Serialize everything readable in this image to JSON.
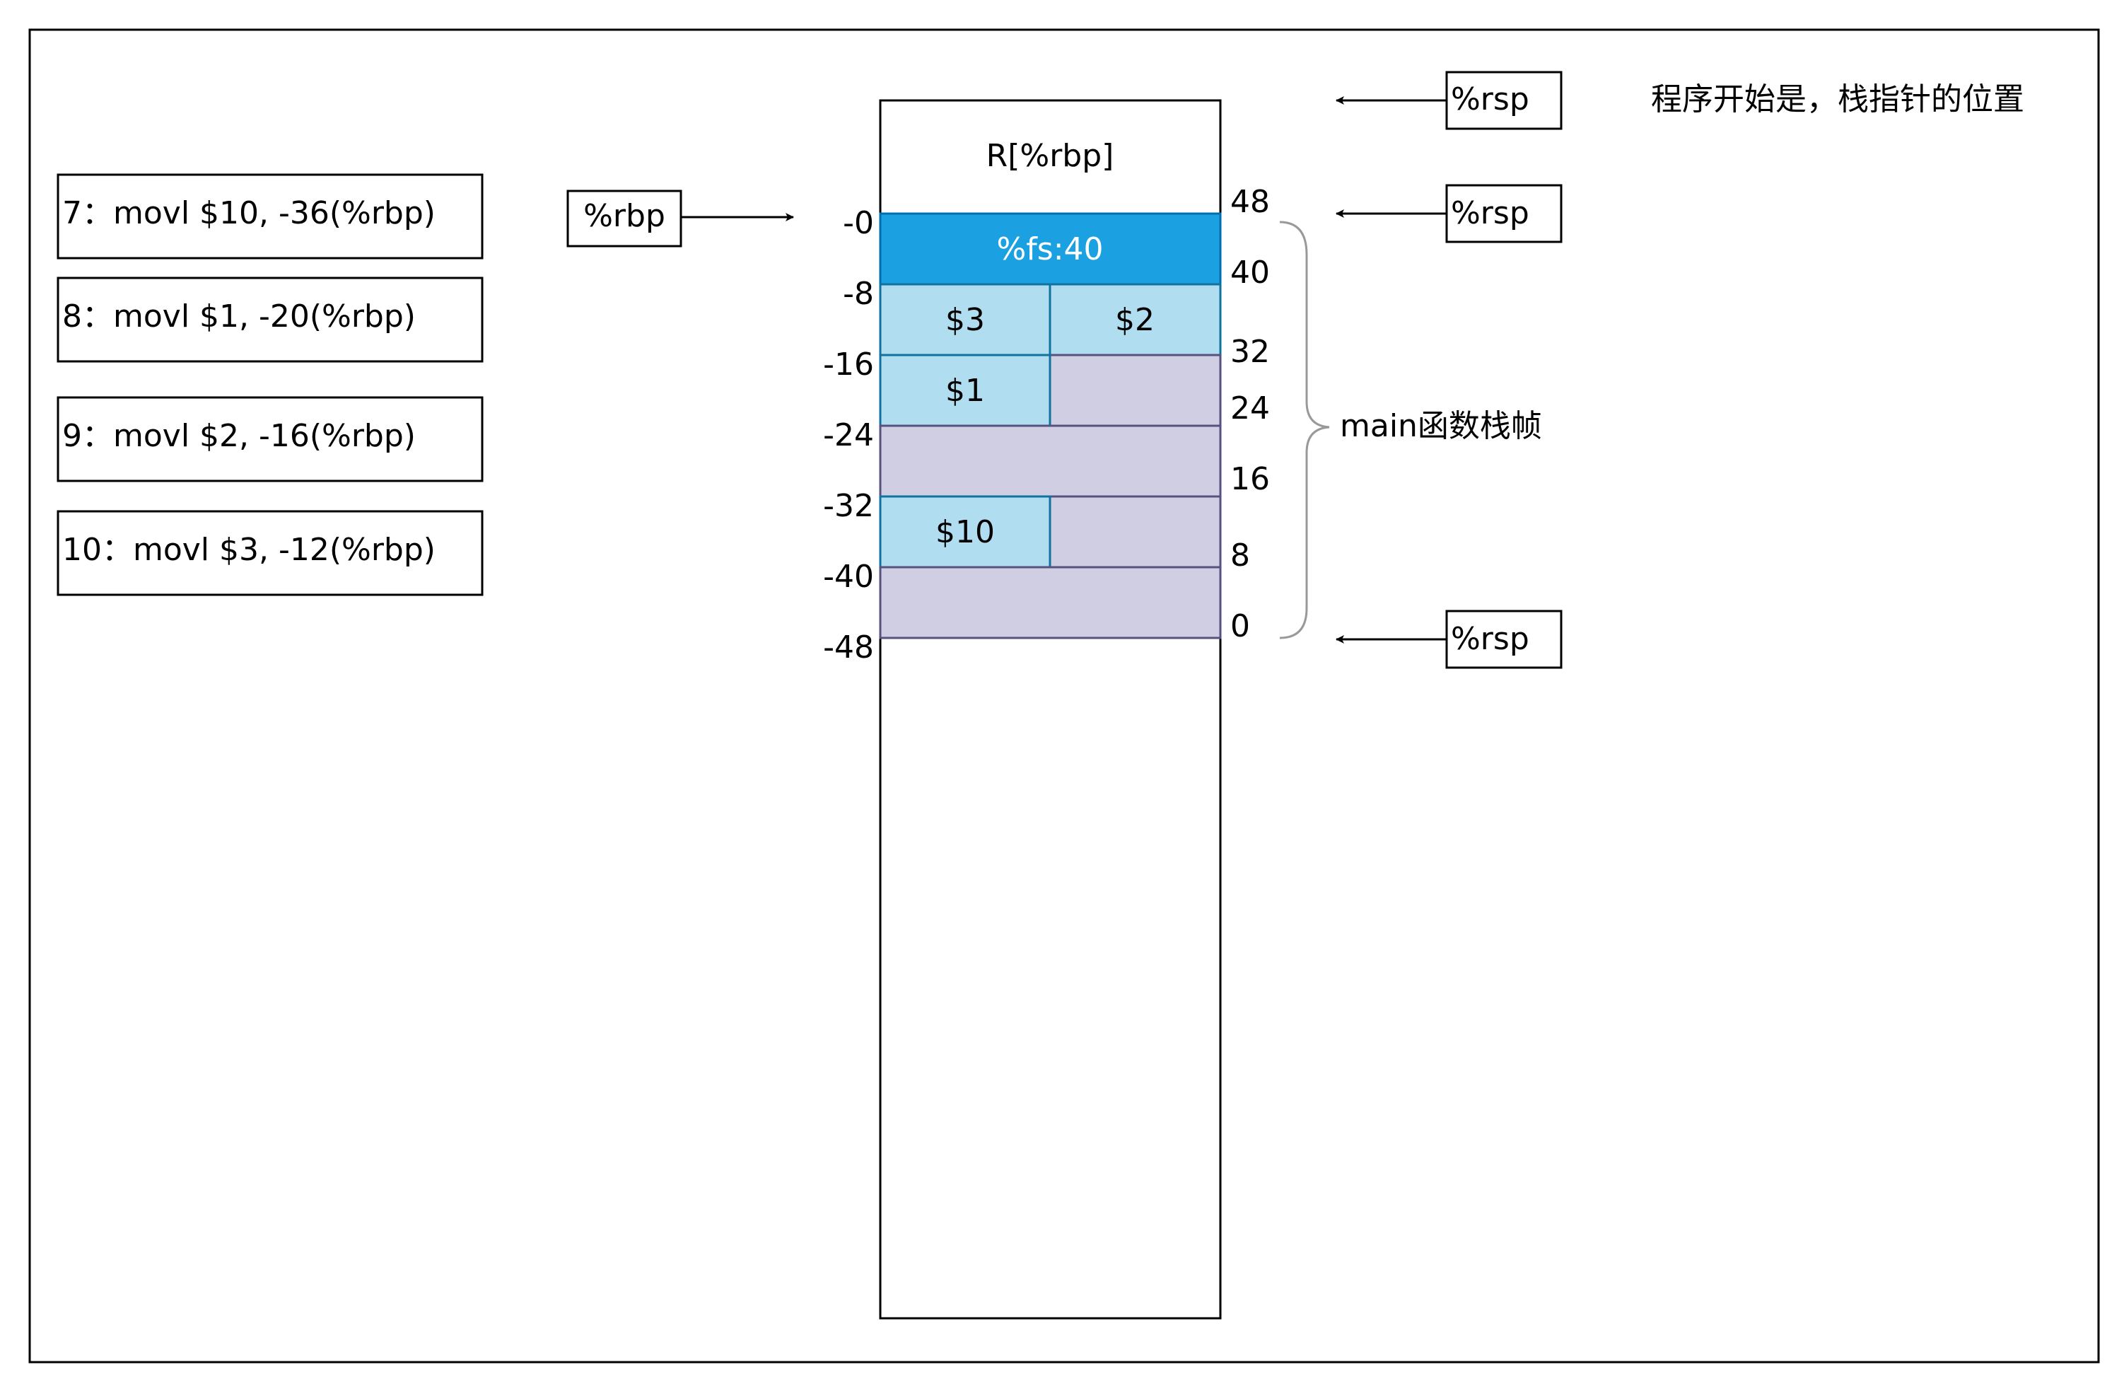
{
  "instructions": [
    "7：movl    $10, -36(%rbp)",
    "8：movl    $1, -20(%rbp)",
    "9：movl    $2, -16(%rbp)",
    "10：movl    $3, -12(%rbp)"
  ],
  "rbp_label": "%rbp",
  "stack_top_label": "R[%rbp]",
  "cells": {
    "fs": "%fs:40",
    "v3": "$3",
    "v2": "$2",
    "v1": "$1",
    "v10": "$10"
  },
  "left_offsets": [
    "-0",
    "-8",
    "-16",
    "-24",
    "-32",
    "-40",
    "-48"
  ],
  "right_offsets": [
    "48",
    "40",
    "32",
    "24",
    "16",
    "8",
    "0"
  ],
  "rsp_label": "%rsp",
  "rsp_note": "程序开始是，栈指针的位置",
  "frame_label": "main函数栈帧",
  "colors": {
    "fs_fill": "#1ba1e2",
    "value_fill": "#b1ddf0",
    "value_stroke": "#10739e",
    "empty_fill": "#d0cee2",
    "empty_stroke": "#56517e",
    "brace": "#999999"
  }
}
